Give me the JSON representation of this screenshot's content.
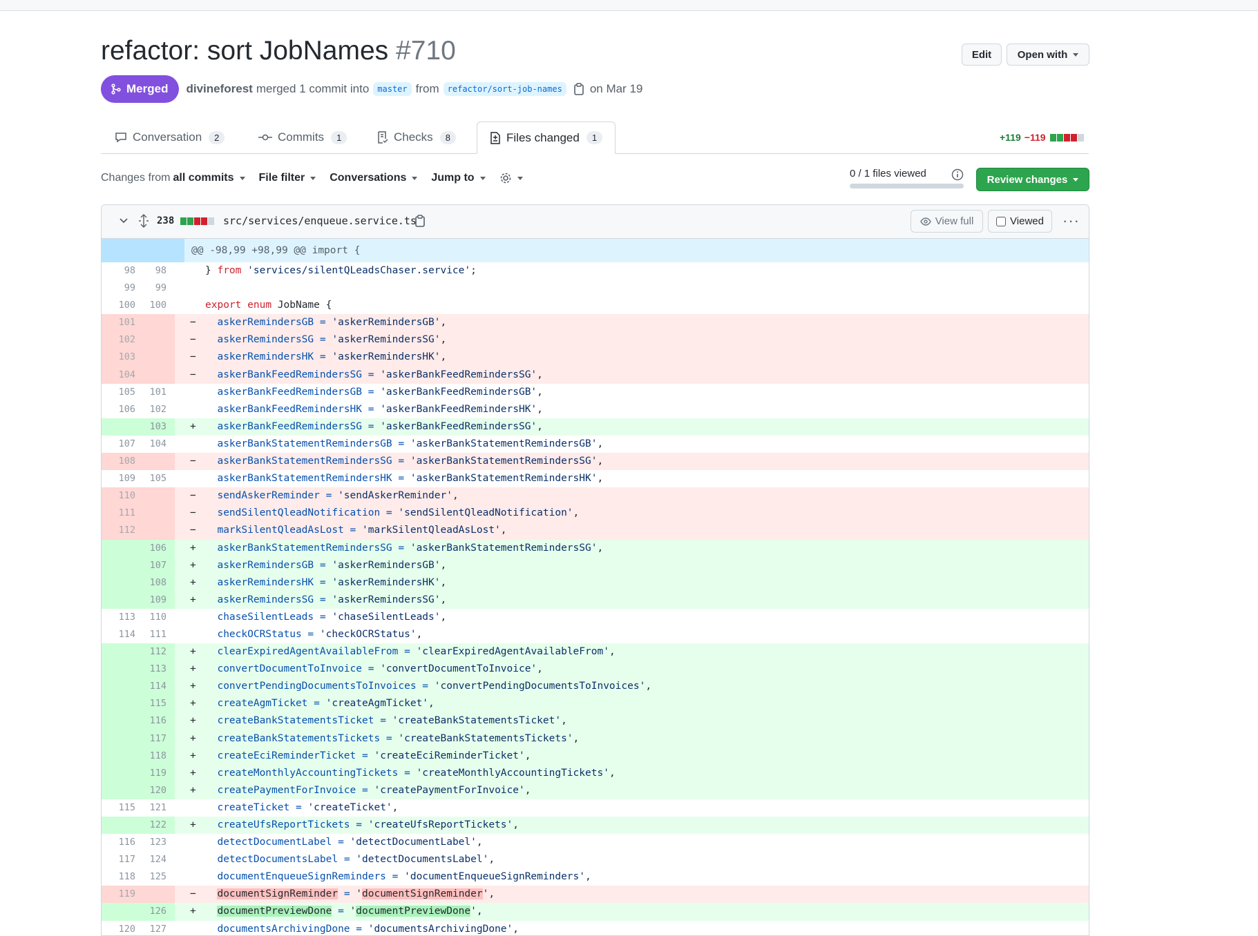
{
  "pr": {
    "title": "refactor: sort JobNames",
    "number": "#710",
    "status": "Merged",
    "author": "divineforest",
    "action": "merged 1 commit into",
    "base_branch": "master",
    "from_word": "from",
    "head_branch": "refactor/sort-job-names",
    "date": "on Mar 19"
  },
  "header_buttons": {
    "edit": "Edit",
    "open_with": "Open with"
  },
  "tabs": [
    {
      "label": "Conversation",
      "count": "2",
      "icon": "comment-icon"
    },
    {
      "label": "Commits",
      "count": "1",
      "icon": "commit-icon"
    },
    {
      "label": "Checks",
      "count": "8",
      "icon": "checklist-icon"
    },
    {
      "label": "Files changed",
      "count": "1",
      "icon": "file-diff-icon",
      "active": true
    }
  ],
  "diffstat": {
    "additions": "+119",
    "deletions": "−119"
  },
  "toolbar": {
    "changes_from_prefix": "Changes from",
    "changes_from_value": "all commits",
    "file_filter": "File filter",
    "conversations": "Conversations",
    "jump_to": "Jump to",
    "files_viewed": "0 / 1 files viewed",
    "review_changes": "Review changes"
  },
  "file": {
    "change_count": "238",
    "path": "src/services/enqueue.service.ts",
    "view_full": "View full",
    "viewed": "Viewed"
  },
  "colors": {
    "merged": "#8250df",
    "add": "#2da44e",
    "delete": "#cf222e",
    "link": "#0969da"
  },
  "hunk": "@@ -98,99 +98,99 @@ import {",
  "diff_lines": [
    {
      "t": "ctx",
      "o": "98",
      "n": "98",
      "html": "} <span class='k'>from</span> <span class='s'>'services/silentQLeadsChaser.service'</span>;"
    },
    {
      "t": "ctx",
      "o": "99",
      "n": "99",
      "html": ""
    },
    {
      "t": "ctx",
      "o": "100",
      "n": "100",
      "html": "<span class='k'>export</span> <span class='k'>enum</span> JobName {"
    },
    {
      "t": "del",
      "o": "101",
      "n": "",
      "key": "askerRemindersGB",
      "val": "askerRemindersGB"
    },
    {
      "t": "del",
      "o": "102",
      "n": "",
      "key": "askerRemindersSG",
      "val": "askerRemindersSG"
    },
    {
      "t": "del",
      "o": "103",
      "n": "",
      "key": "askerRemindersHK",
      "val": "askerRemindersHK"
    },
    {
      "t": "del",
      "o": "104",
      "n": "",
      "key": "askerBankFeedRemindersSG",
      "val": "askerBankFeedRemindersSG"
    },
    {
      "t": "ctx",
      "o": "105",
      "n": "101",
      "key": "askerBankFeedRemindersGB",
      "val": "askerBankFeedRemindersGB"
    },
    {
      "t": "ctx",
      "o": "106",
      "n": "102",
      "key": "askerBankFeedRemindersHK",
      "val": "askerBankFeedRemindersHK"
    },
    {
      "t": "add",
      "o": "",
      "n": "103",
      "key": "askerBankFeedRemindersSG",
      "val": "askerBankFeedRemindersSG"
    },
    {
      "t": "ctx",
      "o": "107",
      "n": "104",
      "key": "askerBankStatementRemindersGB",
      "val": "askerBankStatementRemindersGB"
    },
    {
      "t": "del",
      "o": "108",
      "n": "",
      "key": "askerBankStatementRemindersSG",
      "val": "askerBankStatementRemindersSG"
    },
    {
      "t": "ctx",
      "o": "109",
      "n": "105",
      "key": "askerBankStatementRemindersHK",
      "val": "askerBankStatementRemindersHK"
    },
    {
      "t": "del",
      "o": "110",
      "n": "",
      "key": "sendAskerReminder",
      "val": "sendAskerReminder"
    },
    {
      "t": "del",
      "o": "111",
      "n": "",
      "key": "sendSilentQleadNotification",
      "val": "sendSilentQleadNotification"
    },
    {
      "t": "del",
      "o": "112",
      "n": "",
      "key": "markSilentQleadAsLost",
      "val": "markSilentQleadAsLost"
    },
    {
      "t": "add",
      "o": "",
      "n": "106",
      "key": "askerBankStatementRemindersSG",
      "val": "askerBankStatementRemindersSG"
    },
    {
      "t": "add",
      "o": "",
      "n": "107",
      "key": "askerRemindersGB",
      "val": "askerRemindersGB"
    },
    {
      "t": "add",
      "o": "",
      "n": "108",
      "key": "askerRemindersHK",
      "val": "askerRemindersHK"
    },
    {
      "t": "add",
      "o": "",
      "n": "109",
      "key": "askerRemindersSG",
      "val": "askerRemindersSG"
    },
    {
      "t": "ctx",
      "o": "113",
      "n": "110",
      "key": "chaseSilentLeads",
      "val": "chaseSilentLeads"
    },
    {
      "t": "ctx",
      "o": "114",
      "n": "111",
      "key": "checkOCRStatus",
      "val": "checkOCRStatus"
    },
    {
      "t": "add",
      "o": "",
      "n": "112",
      "key": "clearExpiredAgentAvailableFrom",
      "val": "clearExpiredAgentAvailableFrom"
    },
    {
      "t": "add",
      "o": "",
      "n": "113",
      "key": "convertDocumentToInvoice",
      "val": "convertDocumentToInvoice"
    },
    {
      "t": "add",
      "o": "",
      "n": "114",
      "key": "convertPendingDocumentsToInvoices",
      "val": "convertPendingDocumentsToInvoices"
    },
    {
      "t": "add",
      "o": "",
      "n": "115",
      "key": "createAgmTicket",
      "val": "createAgmTicket"
    },
    {
      "t": "add",
      "o": "",
      "n": "116",
      "key": "createBankStatementsTicket",
      "val": "createBankStatementsTicket"
    },
    {
      "t": "add",
      "o": "",
      "n": "117",
      "key": "createBankStatementsTickets",
      "val": "createBankStatementsTickets"
    },
    {
      "t": "add",
      "o": "",
      "n": "118",
      "key": "createEciReminderTicket",
      "val": "createEciReminderTicket"
    },
    {
      "t": "add",
      "o": "",
      "n": "119",
      "key": "createMonthlyAccountingTickets",
      "val": "createMonthlyAccountingTickets"
    },
    {
      "t": "add",
      "o": "",
      "n": "120",
      "key": "createPaymentForInvoice",
      "val": "createPaymentForInvoice"
    },
    {
      "t": "ctx",
      "o": "115",
      "n": "121",
      "key": "createTicket",
      "val": "createTicket"
    },
    {
      "t": "add",
      "o": "",
      "n": "122",
      "key": "createUfsReportTickets",
      "val": "createUfsReportTickets"
    },
    {
      "t": "ctx",
      "o": "116",
      "n": "123",
      "key": "detectDocumentLabel",
      "val": "detectDocumentLabel"
    },
    {
      "t": "ctx",
      "o": "117",
      "n": "124",
      "key": "detectDocumentsLabel",
      "val": "detectDocumentsLabel"
    },
    {
      "t": "ctx",
      "o": "118",
      "n": "125",
      "key": "documentEnqueueSignReminders",
      "val": "documentEnqueueSignReminders"
    },
    {
      "t": "del",
      "o": "119",
      "n": "",
      "key": "documentSignReminder",
      "val": "documentSignReminder",
      "hl": true
    },
    {
      "t": "add",
      "o": "",
      "n": "126",
      "key": "documentPreviewDone",
      "val": "documentPreviewDone",
      "hl": true
    },
    {
      "t": "ctx",
      "o": "120",
      "n": "127",
      "key": "documentsArchivingDone",
      "val": "documentsArchivingDone"
    }
  ]
}
